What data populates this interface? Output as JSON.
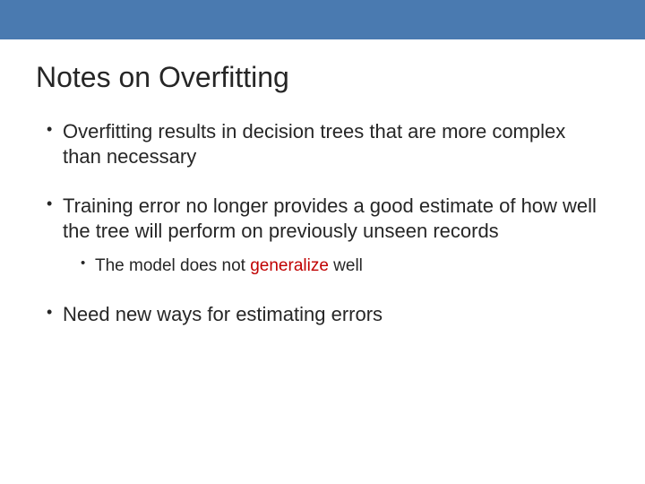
{
  "title": "Notes on Overfitting",
  "bullets": [
    {
      "text": "Overfitting results in decision trees that are more complex than necessary",
      "children": []
    },
    {
      "text": "Training error no longer provides a good estimate of how well the tree will perform on previously unseen records",
      "children": [
        {
          "pre": "The model does not ",
          "accent": "generalize",
          "post": " well"
        }
      ]
    },
    {
      "text": "Need new ways for estimating errors",
      "children": []
    }
  ]
}
